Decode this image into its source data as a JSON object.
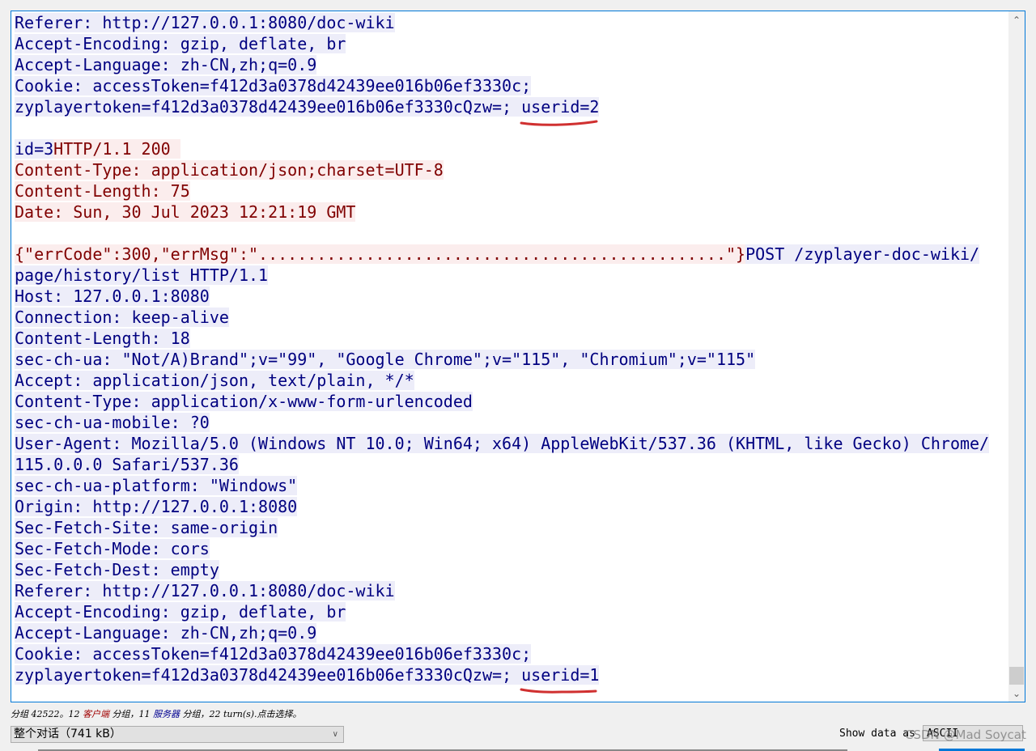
{
  "stream_lines": [
    [
      {
        "t": "Referer: http://127.0.0.1:8080/doc-wiki",
        "w": "c"
      }
    ],
    [
      {
        "t": "Accept-Encoding: gzip, deflate, br",
        "w": "c"
      }
    ],
    [
      {
        "t": "Accept-Language: zh-CN,zh;q=0.9",
        "w": "c"
      }
    ],
    [
      {
        "t": "Cookie: accessToken=f412d3a0378d42439ee016b06ef3330c;",
        "w": "c"
      }
    ],
    [
      {
        "t": "zyplayertoken=f412d3a0378d42439ee016b06ef3330cQzw=; userid=2",
        "w": "c"
      }
    ],
    [],
    [
      {
        "t": "id=3",
        "w": "c"
      },
      {
        "t": "HTTP/1.1 200 ",
        "w": "s"
      }
    ],
    [
      {
        "t": "Content-Type: application/json;charset=UTF-8",
        "w": "s"
      }
    ],
    [
      {
        "t": "Content-Length: 75",
        "w": "s"
      }
    ],
    [
      {
        "t": "Date: Sun, 30 Jul 2023 12:21:19 GMT",
        "w": "s"
      }
    ],
    [],
    [
      {
        "t": "{\"errCode\":300,\"errMsg\":\"................................................\"}",
        "w": "s"
      },
      {
        "t": "POST /zyplayer-doc-wiki/",
        "w": "c"
      }
    ],
    [
      {
        "t": "page/history/list HTTP/1.1",
        "w": "c"
      }
    ],
    [
      {
        "t": "Host: 127.0.0.1:8080",
        "w": "c"
      }
    ],
    [
      {
        "t": "Connection: keep-alive",
        "w": "c"
      }
    ],
    [
      {
        "t": "Content-Length: 18",
        "w": "c"
      }
    ],
    [
      {
        "t": "sec-ch-ua: \"Not/A)Brand\";v=\"99\", \"Google Chrome\";v=\"115\", \"Chromium\";v=\"115\"",
        "w": "c"
      }
    ],
    [
      {
        "t": "Accept: application/json, text/plain, */*",
        "w": "c"
      }
    ],
    [
      {
        "t": "Content-Type: application/x-www-form-urlencoded",
        "w": "c"
      }
    ],
    [
      {
        "t": "sec-ch-ua-mobile: ?0",
        "w": "c"
      }
    ],
    [
      {
        "t": "User-Agent: Mozilla/5.0 (Windows NT 10.0; Win64; x64) AppleWebKit/537.36 (KHTML, like Gecko) Chrome/",
        "w": "c"
      }
    ],
    [
      {
        "t": "115.0.0.0 Safari/537.36",
        "w": "c"
      }
    ],
    [
      {
        "t": "sec-ch-ua-platform: \"Windows\"",
        "w": "c"
      }
    ],
    [
      {
        "t": "Origin: http://127.0.0.1:8080",
        "w": "c"
      }
    ],
    [
      {
        "t": "Sec-Fetch-Site: same-origin",
        "w": "c"
      }
    ],
    [
      {
        "t": "Sec-Fetch-Mode: cors",
        "w": "c"
      }
    ],
    [
      {
        "t": "Sec-Fetch-Dest: empty",
        "w": "c"
      }
    ],
    [
      {
        "t": "Referer: http://127.0.0.1:8080/doc-wiki",
        "w": "c"
      }
    ],
    [
      {
        "t": "Accept-Encoding: gzip, deflate, br",
        "w": "c"
      }
    ],
    [
      {
        "t": "Accept-Language: zh-CN,zh;q=0.9",
        "w": "c"
      }
    ],
    [
      {
        "t": "Cookie: accessToken=f412d3a0378d42439ee016b06ef3330c;",
        "w": "c"
      }
    ],
    [
      {
        "t": "zyplayertoken=f412d3a0378d42439ee016b06ef3330cQzw=; userid=1",
        "w": "c"
      }
    ]
  ],
  "status": {
    "prefix": "分组 42522。12 ",
    "client": "客户端",
    "middle": " 分组，11 ",
    "server": "服务器",
    "suffix": " 分组，22 turn(s).点击选择。"
  },
  "conversation_select": "整个对话（741 kB）",
  "show_data_label": "Show data as",
  "show_data_value": "ASCII",
  "watermark": "CSDN @Mad Soycat",
  "colors": {
    "client_text": "#000080",
    "client_bg": "#ededf9",
    "server_text": "#800000",
    "server_bg": "#fbeded",
    "annotation": "#d03030",
    "focus_border": "#0078d7"
  }
}
